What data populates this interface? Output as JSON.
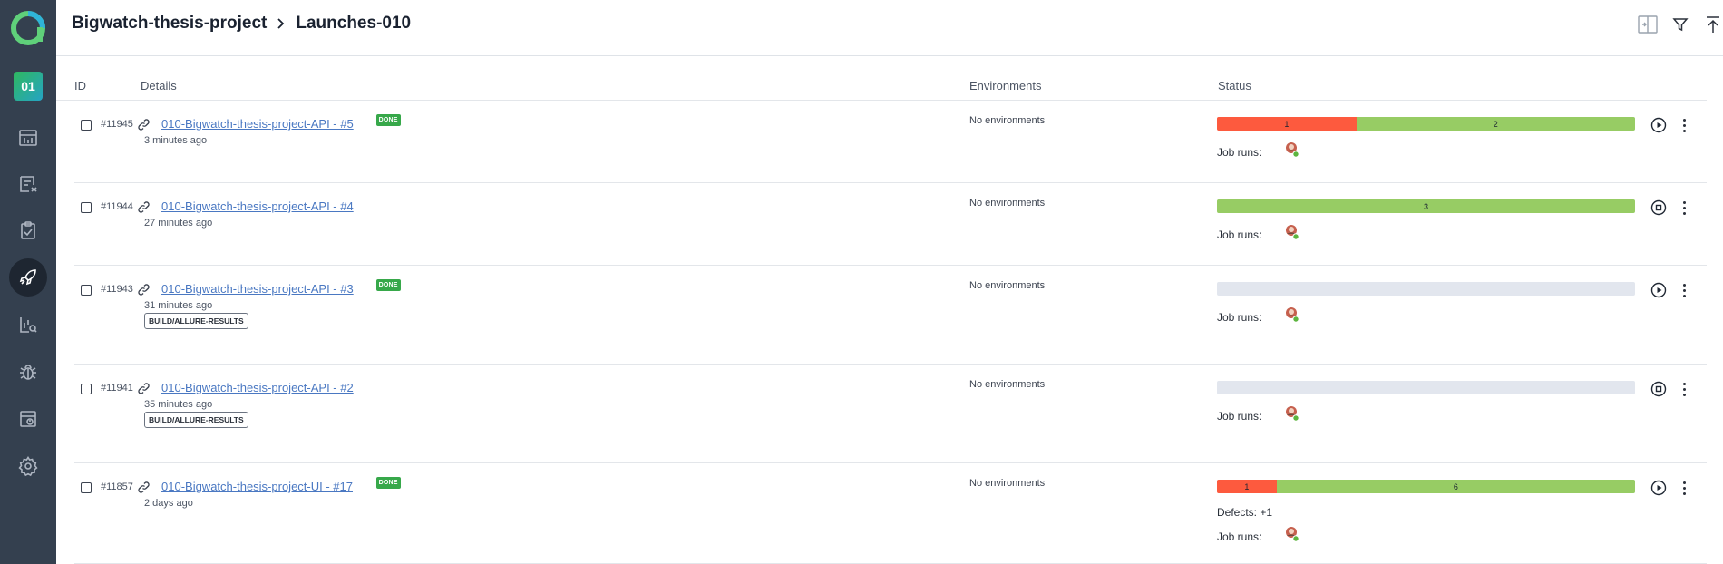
{
  "app": {
    "project_badge": "01"
  },
  "sidebar": {
    "items": [
      {
        "name": "dashboards-icon",
        "active": false
      },
      {
        "name": "test-cases-icon",
        "active": false
      },
      {
        "name": "test-plans-icon",
        "active": false
      },
      {
        "name": "launches-icon",
        "active": true
      },
      {
        "name": "analytics-icon",
        "active": false
      },
      {
        "name": "defects-icon",
        "active": false
      },
      {
        "name": "jobs-icon",
        "active": false
      },
      {
        "name": "settings-icon",
        "active": false
      }
    ]
  },
  "header": {
    "project": "Bigwatch-thesis-project",
    "page": "Launches-010",
    "icons": [
      "compare-icon",
      "filter-icon",
      "upload-icon"
    ]
  },
  "table": {
    "columns": {
      "id": "ID",
      "details": "Details",
      "environments": "Environments",
      "status": "Status"
    },
    "job_runs_label": "Job runs:",
    "rows": [
      {
        "id": "#11945",
        "name": "010-Bigwatch-thesis-project-API - #5",
        "done": "DONE",
        "time": "3 minutes ago",
        "tag": "",
        "environment": "No environments",
        "status": [
          {
            "kind": "failed",
            "count": 1,
            "color": "#fd5a3e"
          },
          {
            "kind": "passed",
            "count": 2,
            "color": "#97cc64"
          }
        ],
        "defects": "",
        "action": "play-icon"
      },
      {
        "id": "#11944",
        "name": "010-Bigwatch-thesis-project-API - #4",
        "done": "",
        "time": "27 minutes ago",
        "tag": "",
        "environment": "No environments",
        "status": [
          {
            "kind": "passed",
            "count": 3,
            "color": "#97cc64"
          }
        ],
        "defects": "",
        "action": "stop-icon"
      },
      {
        "id": "#11943",
        "name": "010-Bigwatch-thesis-project-API - #3",
        "done": "DONE",
        "time": "31 minutes ago",
        "tag": "BUILD/ALLURE-RESULTS",
        "environment": "No environments",
        "status": [],
        "defects": "",
        "action": "play-icon"
      },
      {
        "id": "#11941",
        "name": "010-Bigwatch-thesis-project-API - #2",
        "done": "",
        "time": "35 minutes ago",
        "tag": "BUILD/ALLURE-RESULTS",
        "environment": "No environments",
        "status": [],
        "defects": "",
        "action": "stop-icon"
      },
      {
        "id": "#11857",
        "name": "010-Bigwatch-thesis-project-UI - #17",
        "done": "DONE",
        "time": "2 days ago",
        "tag": "",
        "environment": "No environments",
        "status": [
          {
            "kind": "failed",
            "count": 1,
            "color": "#fd5a3e"
          },
          {
            "kind": "passed",
            "count": 6,
            "color": "#97cc64"
          }
        ],
        "defects": "Defects: +1",
        "action": "play-icon"
      }
    ]
  }
}
